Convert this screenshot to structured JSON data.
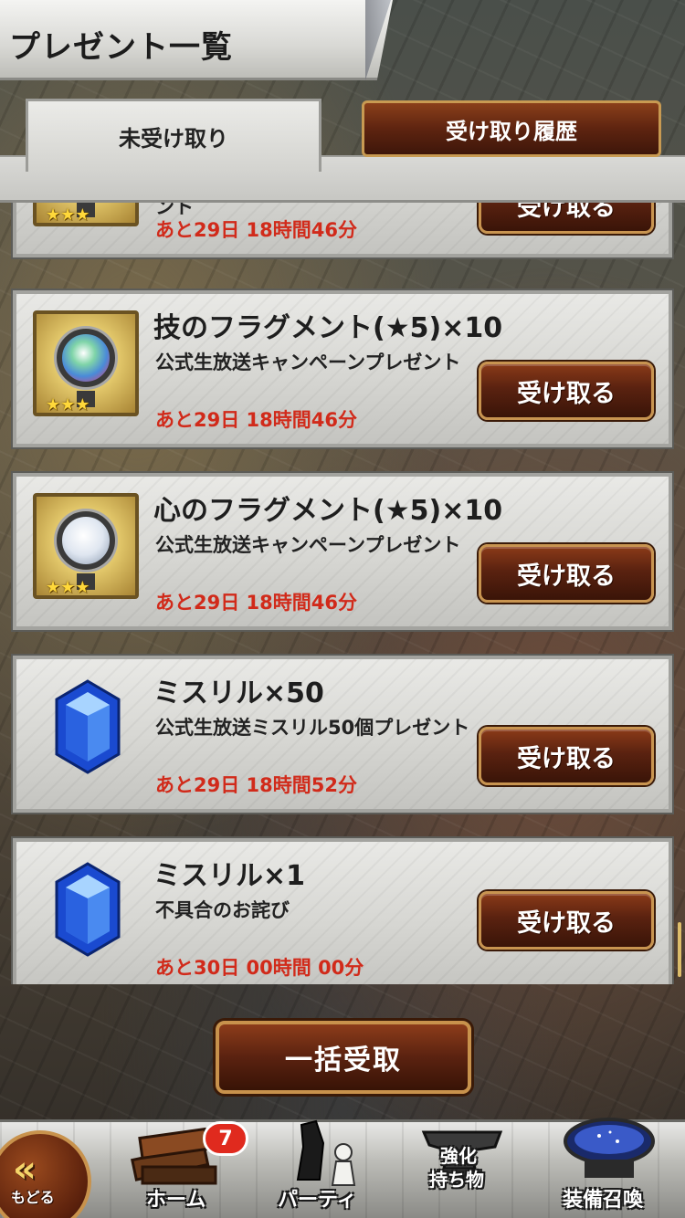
{
  "header": {
    "title": "プレゼント一覧"
  },
  "tabs": {
    "unreceived": "未受け取り",
    "history": "受け取り履歴"
  },
  "items": [
    {
      "name": "",
      "desc": "ント",
      "time": "あと29日 18時間46分",
      "button": "受け取る",
      "icon": "fragment-orb-icon"
    },
    {
      "name": "技のフラグメント(★5)×10",
      "desc": "公式生放送キャンペーンプレゼント",
      "time": "あと29日 18時間46分",
      "button": "受け取る",
      "icon": "skill-fragment-icon"
    },
    {
      "name": "心のフラグメント(★5)×10",
      "desc": "公式生放送キャンペーンプレゼント",
      "time": "あと29日 18時間46分",
      "button": "受け取る",
      "icon": "heart-fragment-icon"
    },
    {
      "name": "ミスリル×50",
      "desc": "公式生放送ミスリル50個プレゼント",
      "time": "あと29日 18時間52分",
      "button": "受け取る",
      "icon": "mythril-gem-icon"
    },
    {
      "name": "ミスリル×1",
      "desc": "不具合のお詫び",
      "time": "あと30日 00時間 00分",
      "button": "受け取る",
      "icon": "mythril-gem-icon"
    }
  ],
  "stars": "★★★",
  "bulk_button": "一括受取",
  "nav": {
    "back": "もどる",
    "home": "ホーム",
    "home_badge": "7",
    "party": "パーティ",
    "enhance": "強化\n持ち物",
    "enhance_line1": "強化",
    "enhance_line2": "持ち物",
    "summon": "装備召喚"
  },
  "colors": {
    "timer_red": "#d12a1a",
    "button_brown": "#5a2210",
    "button_gold_border": "#c89450",
    "badge_red": "#e02a1e"
  }
}
